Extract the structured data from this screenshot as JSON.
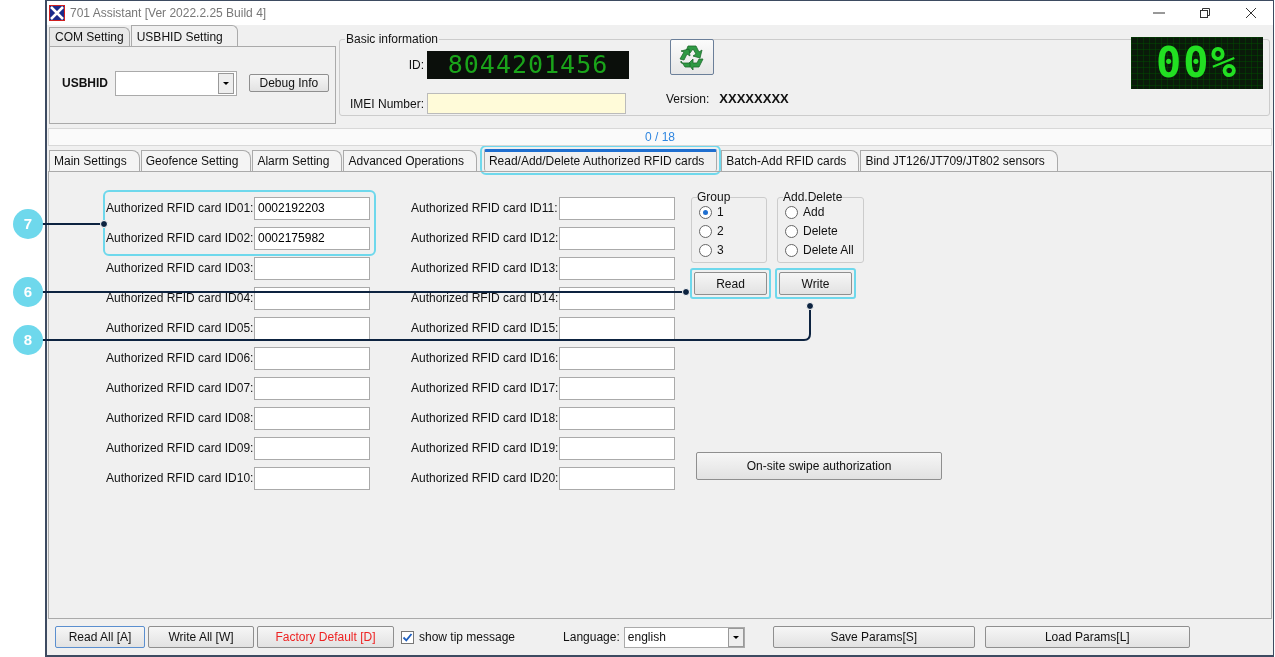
{
  "window": {
    "title": "701 Assistant [Ver 2022.2.25 Build 4]"
  },
  "connection_tabs": [
    {
      "label": "COM Setting",
      "selected": false
    },
    {
      "label": "USBHID Setting",
      "selected": true
    }
  ],
  "usbhid": {
    "label": "USBHID",
    "debug_button": "Debug Info"
  },
  "basic_info": {
    "title": "Basic information",
    "id_label": "ID:",
    "id_value": "8044201456",
    "imei_label": "IMEI Number:",
    "version_label": "Version:",
    "version_value": "XXXXXXXX"
  },
  "led_display": "00%",
  "progress": {
    "text": "0 / 18",
    "level": 0
  },
  "tabs": [
    {
      "label": "Main Settings",
      "selected": false,
      "highlighted": false
    },
    {
      "label": "Geofence Setting",
      "selected": false,
      "highlighted": false
    },
    {
      "label": "Alarm Setting",
      "selected": false,
      "highlighted": false
    },
    {
      "label": "Advanced Operations",
      "selected": false,
      "highlighted": false
    },
    {
      "label": "Read/Add/Delete Authorized RFID cards",
      "selected": true,
      "highlighted": true
    },
    {
      "label": "Batch-Add RFID cards",
      "selected": false,
      "highlighted": false
    },
    {
      "label": "Bind JT126/JT709/JT802 sensors",
      "selected": false,
      "highlighted": false
    }
  ],
  "cards": [
    {
      "label": "Authorized RFID card ID01:",
      "value": "0002192203",
      "highlighted": true
    },
    {
      "label": "Authorized RFID card ID02:",
      "value": "0002175982",
      "highlighted": true
    },
    {
      "label": "Authorized RFID card ID03:",
      "highlighted": false
    },
    {
      "label": "Authorized RFID card ID04:",
      "highlighted": false
    },
    {
      "label": "Authorized RFID card ID05:",
      "highlighted": false
    },
    {
      "label": "Authorized RFID card ID06:",
      "highlighted": false
    },
    {
      "label": "Authorized RFID card ID07:",
      "highlighted": false
    },
    {
      "label": "Authorized RFID card ID08:",
      "highlighted": false
    },
    {
      "label": "Authorized RFID card ID09:",
      "highlighted": false
    },
    {
      "label": "Authorized RFID card ID10:",
      "highlighted": false
    },
    {
      "label": "Authorized RFID card ID11:",
      "highlighted": false
    },
    {
      "label": "Authorized RFID card ID12:",
      "highlighted": false
    },
    {
      "label": "Authorized RFID card ID13:",
      "highlighted": false
    },
    {
      "label": "Authorized RFID card ID14:",
      "highlighted": false
    },
    {
      "label": "Authorized RFID card ID15:",
      "highlighted": false
    },
    {
      "label": "Authorized RFID card ID16:",
      "highlighted": false
    },
    {
      "label": "Authorized RFID card ID17:",
      "highlighted": false
    },
    {
      "label": "Authorized RFID card ID18:",
      "highlighted": false
    },
    {
      "label": "Authorized RFID card ID19:",
      "highlighted": false
    },
    {
      "label": "Authorized RFID card ID20:",
      "highlighted": false
    }
  ],
  "group": {
    "title": "Group",
    "options": [
      {
        "label": "1",
        "selected": true
      },
      {
        "label": "2",
        "selected": false
      },
      {
        "label": "3",
        "selected": false
      }
    ]
  },
  "add_delete": {
    "title": "Add.Delete",
    "options": [
      {
        "label": "Add",
        "selected": false
      },
      {
        "label": "Delete",
        "selected": false
      },
      {
        "label": "Delete All",
        "selected": false
      }
    ]
  },
  "read_button": {
    "label": "Read",
    "highlighted": true
  },
  "write_button": {
    "label": "Write",
    "highlighted": true
  },
  "swipe_button": "On-site swipe authorization",
  "footer": {
    "buttons": [
      {
        "label": "Read All [A]",
        "kind": "default"
      },
      {
        "label": "Write All [W]",
        "kind": "normal"
      },
      {
        "label": "Factory Default [D]",
        "kind": "danger"
      }
    ],
    "show_tip": {
      "label": "show tip message",
      "checked": true
    },
    "language_label": "Language:",
    "language_value": "english",
    "save_button": "Save Params[S]",
    "load_button": "Load Params[L]"
  },
  "callouts": [
    {
      "number": "7"
    },
    {
      "number": "6"
    },
    {
      "number": "8"
    }
  ]
}
